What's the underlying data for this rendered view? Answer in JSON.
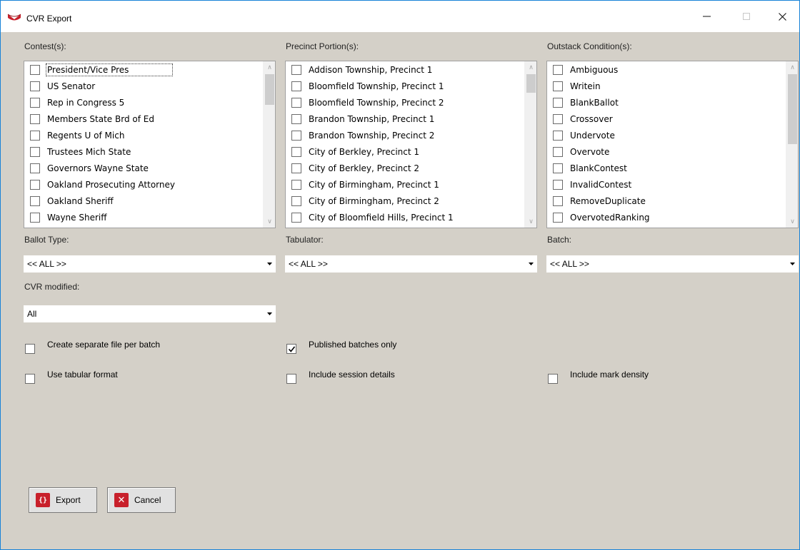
{
  "window": {
    "title": "CVR Export",
    "minimize_glyph": "—",
    "maximize_glyph": "☐",
    "close_glyph": "✕",
    "accent": "#1883d7",
    "icon": "app-logo-icon"
  },
  "contests": {
    "label": "Contest(s):",
    "items": [
      "President/Vice Pres",
      "US Senator",
      "Rep in Congress 5",
      "Members State Brd of Ed",
      "Regents U of Mich",
      "Trustees Mich State",
      "Governors Wayne State",
      "Oakland Prosecuting Attorney",
      "Oakland Sheriff",
      "Wayne Sheriff"
    ],
    "scroll_up": "∧",
    "scroll_down": "∨"
  },
  "precincts": {
    "label": "Precinct Portion(s):",
    "items": [
      "Addison Township, Precinct 1",
      "Bloomfield Township, Precinct 1",
      "Bloomfield Township, Precinct 2",
      "Brandon Township, Precinct 1",
      "Brandon Township, Precinct 2",
      "City of Berkley, Precinct 1",
      "City of Berkley, Precinct 2",
      "City of Birmingham, Precinct 1",
      "City of Birmingham, Precinct 2",
      "City of Bloomfield Hills, Precinct 1"
    ],
    "scroll_up": "∧",
    "scroll_down": "∨"
  },
  "outstack": {
    "label": "Outstack Condition(s):",
    "items": [
      "Ambiguous",
      "Writein",
      "BlankBallot",
      "Crossover",
      "Undervote",
      "Overvote",
      "BlankContest",
      "InvalidContest",
      "RemoveDuplicate",
      "OvervotedRanking"
    ],
    "scroll_up": "∧",
    "scroll_down": "∨"
  },
  "ballot_type": {
    "label": "Ballot Type:",
    "value": "<< ALL >>"
  },
  "tabulator": {
    "label": "Tabulator:",
    "value": "<< ALL >>"
  },
  "batch": {
    "label": "Batch:",
    "value": "<< ALL >>"
  },
  "cvr_modified": {
    "label": "CVR modified:",
    "value": "All"
  },
  "options": {
    "separate_file": {
      "label": "Create separate file per batch",
      "checked": false
    },
    "published_only": {
      "label": "Published batches only",
      "checked": true
    },
    "tabular_format": {
      "label": "Use tabular format",
      "checked": false
    },
    "session_details": {
      "label": "Include session details",
      "checked": false
    },
    "mark_density": {
      "label": "Include mark density",
      "checked": false
    }
  },
  "buttons": {
    "export": {
      "label": "Export",
      "icon_glyph": "{}",
      "icon": "braces-icon",
      "color": "#c8202b"
    },
    "cancel": {
      "label": "Cancel",
      "icon_glyph": "✕",
      "icon": "close-x-icon",
      "color": "#c8202b"
    }
  }
}
